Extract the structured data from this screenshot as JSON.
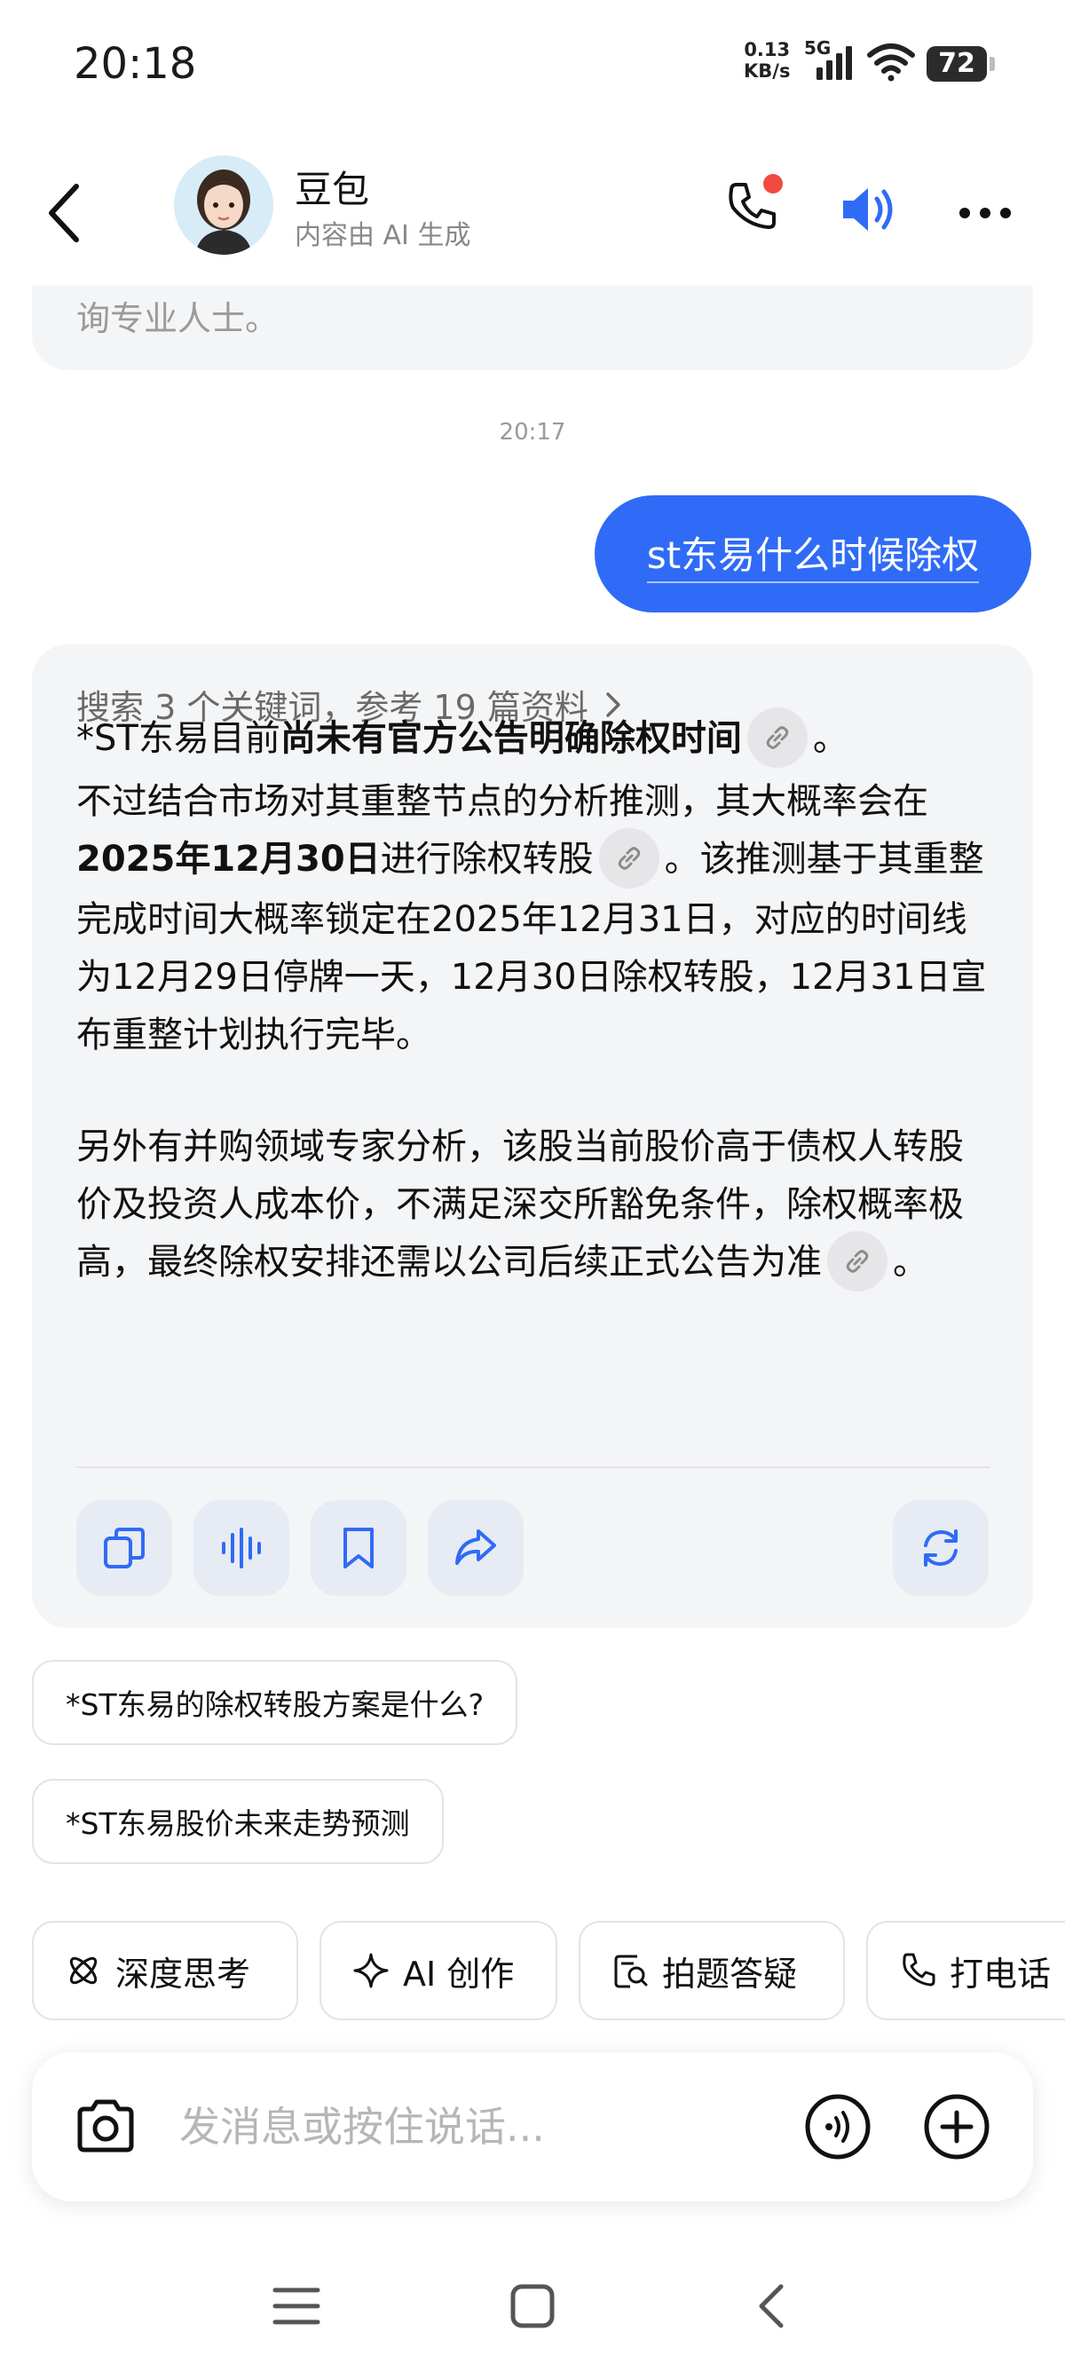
{
  "status_bar": {
    "time": "20:18",
    "net_speed_value": "0.13",
    "net_speed_unit": "KB/s",
    "network_type": "5G",
    "battery": "72"
  },
  "header": {
    "name": "豆包",
    "subtitle": "内容由 AI 生成"
  },
  "chat": {
    "previous_tail": "询专业人士。",
    "timestamp": "20:17",
    "user_message": "st东易什么时候除权",
    "assistant": {
      "search_summary": "搜索 3 个关键词，参考 19 篇资料",
      "p1_prefix": "*ST东易目前",
      "p1_bold": "尚未有官方公告明确除权时间",
      "p1_suffix": "。",
      "p2_line1": "不过结合市场对其重整节点的分析推测，其大概率会",
      "p2_prefix": "在",
      "p2_bold": "2025年12月30日",
      "p2_mid": "进行除权转股",
      "p2_suffix": "。该推测基于其重整完成时间大概率锁定在2025年12月31日，对应的时间线为12月29日停牌一天，12月30日除权转股，12月31日宣布重整计划执行完毕。",
      "p3_text": "另外有并购领域专家分析，该股当前股价高于债权人转股价及投资人成本价，不满足深交所豁免条件，除权概率极高，最终除权安排还需以公司后续正式公告为准",
      "p3_suffix": "。"
    }
  },
  "suggestions": [
    "*ST东易的除权转股方案是什么?",
    "*ST东易股价未来走势预测"
  ],
  "tools": [
    {
      "label": "深度思考",
      "icon": "atom-icon"
    },
    {
      "label": "AI 创作",
      "icon": "sparkle-icon"
    },
    {
      "label": "拍题答疑",
      "icon": "scan-question-icon"
    },
    {
      "label": "打电话",
      "icon": "phone-icon"
    }
  ],
  "input": {
    "placeholder": "发消息或按住说话..."
  },
  "colors": {
    "accent": "#2f6bf6",
    "card_bg": "#f4f5f7",
    "action_btn_bg": "#e7ebf4",
    "notification": "#f24a3f"
  }
}
